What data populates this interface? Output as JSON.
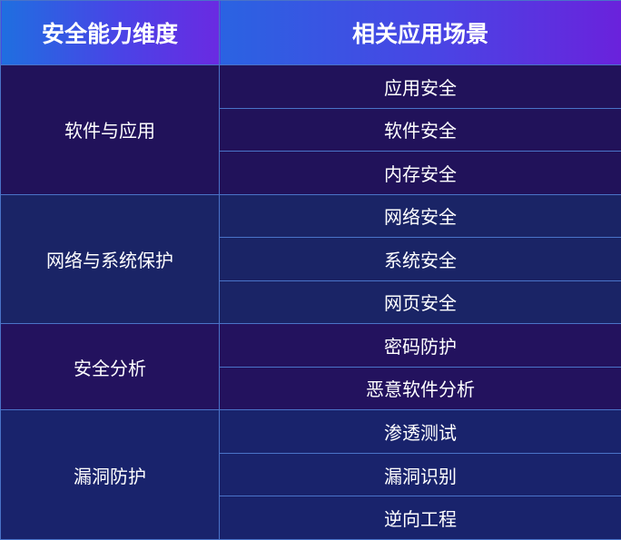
{
  "table": {
    "headers": [
      "安全能力维度",
      "相关应用场景"
    ],
    "groups": [
      {
        "dimension": "软件与应用",
        "scenarios": [
          "应用安全",
          "软件安全",
          "内存安全"
        ]
      },
      {
        "dimension": "网络与系统保护",
        "scenarios": [
          "网络安全",
          "系统安全",
          "网页安全"
        ]
      },
      {
        "dimension": "安全分析",
        "scenarios": [
          "密码防护",
          "恶意软件分析"
        ]
      },
      {
        "dimension": "漏洞防护",
        "scenarios": [
          "渗透测试",
          "漏洞识别",
          "逆向工程"
        ]
      }
    ]
  },
  "colors": {
    "header_gradient_start": "#1f6fe0",
    "header_gradient_end": "#6a2ae2",
    "border": "#4a73c8",
    "text": "#ffffff"
  }
}
